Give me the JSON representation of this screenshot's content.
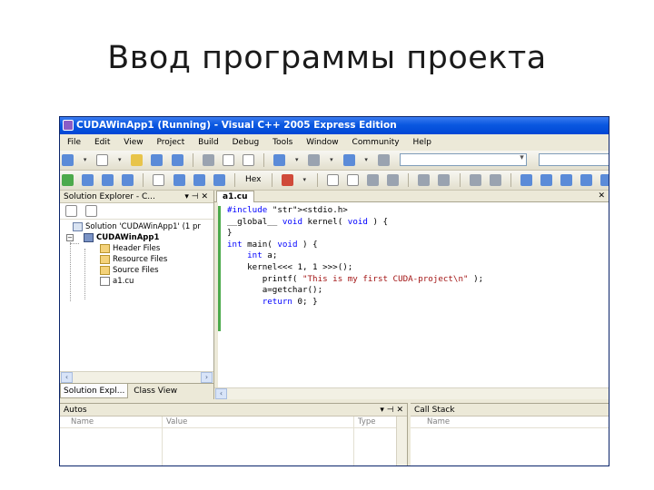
{
  "slide": {
    "title": "Ввод программы проекта"
  },
  "window": {
    "title": "CUDAWinApp1 (Running) - Visual C++ 2005 Express Edition"
  },
  "menu": [
    "File",
    "Edit",
    "View",
    "Project",
    "Build",
    "Debug",
    "Tools",
    "Window",
    "Community",
    "Help"
  ],
  "toolbar": {
    "hex_label": "Hex"
  },
  "solution_explorer": {
    "title": "Solution Explorer - C...",
    "controls": "▾ ⊣ ✕",
    "tree": {
      "solution": "Solution 'CUDAWinApp1' (1 pr",
      "project": "CUDAWinApp1",
      "folders": [
        "Header Files",
        "Resource Files",
        "Source Files"
      ],
      "file": "a1.cu"
    },
    "tabs": [
      "Solution Expl...",
      "Class View"
    ]
  },
  "editor": {
    "tab": "a1.cu",
    "close": "✕",
    "code_lines": [
      "#include <stdio.h>",
      "__global__ void kernel( void ) {",
      "}",
      "int main( void ) {",
      "    int a;",
      "    kernel<<< 1, 1 >>>();",
      "       printf( \"This is my first CUDA-project\\n\" );",
      "       a=getchar();",
      "       return 0; }"
    ]
  },
  "autos": {
    "title": "Autos",
    "controls": "▾ ⊣ ✕",
    "columns": [
      "Name",
      "Value",
      "Type"
    ]
  },
  "call_stack": {
    "title": "Call Stack",
    "columns": [
      "Name"
    ]
  }
}
